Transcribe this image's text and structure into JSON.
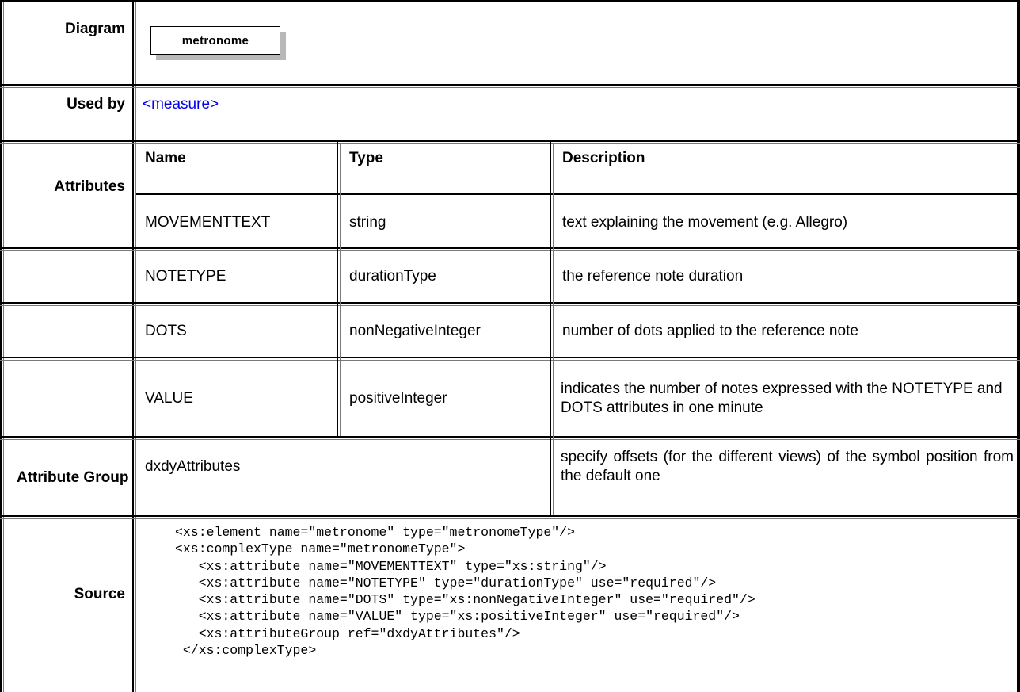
{
  "rows": {
    "diagram": {
      "label": "Diagram",
      "element_name": "metronome"
    },
    "used_by": {
      "label": "Used by",
      "link": "<measure>"
    },
    "attributes": {
      "label": "Attributes",
      "columns": [
        "Name",
        "Type",
        "Description"
      ],
      "items": [
        {
          "name": "MOVEMENTTEXT",
          "type": "string",
          "description": "text explaining the movement (e.g. Allegro)"
        },
        {
          "name": "NOTETYPE",
          "type": "durationType",
          "description": "the reference note duration"
        },
        {
          "name": "DOTS",
          "type": "nonNegativeInteger",
          "description": "number of dots applied to the reference note"
        },
        {
          "name": "VALUE",
          "type": "positiveInteger",
          "description": "indicates the number of notes expressed with the NOTETYPE and DOTS attributes in one minute"
        }
      ]
    },
    "attribute_group": {
      "label": "Attribute Group",
      "name": "dxdyAttributes",
      "description": "specify offsets (for the different views) of the symbol position from the default one"
    },
    "source": {
      "label": "Source",
      "code": "<xs:element name=\"metronome\" type=\"metronomeType\"/>\n<xs:complexType name=\"metronomeType\">\n   <xs:attribute name=\"MOVEMENTTEXT\" type=\"xs:string\"/>\n   <xs:attribute name=\"NOTETYPE\" type=\"durationType\" use=\"required\"/>\n   <xs:attribute name=\"DOTS\" type=\"xs:nonNegativeInteger\" use=\"required\"/>\n   <xs:attribute name=\"VALUE\" type=\"xs:positiveInteger\" use=\"required\"/>\n   <xs:attributeGroup ref=\"dxdyAttributes\"/>\n </xs:complexType>"
    }
  }
}
